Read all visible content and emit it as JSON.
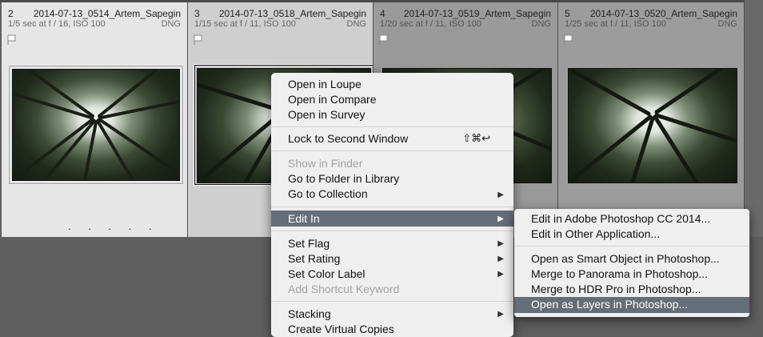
{
  "cells": [
    {
      "num": "2",
      "filename": "2014-07-13_0514_Artem_Sapegin",
      "exposure": "1/5 sec at f / 16, ISO 100",
      "format": "DNG"
    },
    {
      "num": "3",
      "filename": "2014-07-13_0518_Artem_Sapegin",
      "exposure": "1/15 sec at f / 11, ISO 100",
      "format": "DNG"
    },
    {
      "num": "4",
      "filename": "2014-07-13_0519_Artem_Sapegin",
      "exposure": "1/20 sec at f / 11, ISO 100",
      "format": "DNG"
    },
    {
      "num": "5",
      "filename": "2014-07-13_0520_Artem_Sapegin",
      "exposure": "1/25 sec at f / 11, ISO 100",
      "format": "DNG"
    }
  ],
  "rating_dots": ". . . . .",
  "icons": {
    "flag": "flag-icon",
    "submenu_arrow": "triangle-right-icon"
  },
  "context_menu": {
    "open_in_loupe": "Open in Loupe",
    "open_in_compare": "Open in Compare",
    "open_in_survey": "Open in Survey",
    "lock_second_window": "Lock to Second Window",
    "lock_shortcut": "⇧⌘↩",
    "show_in_finder": "Show in Finder",
    "go_to_folder": "Go to Folder in Library",
    "go_to_collection": "Go to Collection",
    "edit_in": "Edit In",
    "set_flag": "Set Flag",
    "set_rating": "Set Rating",
    "set_color_label": "Set Color Label",
    "add_shortcut_keyword": "Add Shortcut Keyword",
    "stacking": "Stacking",
    "create_virtual_copies": "Create Virtual Copies"
  },
  "submenu": {
    "edit_photoshop": "Edit in Adobe Photoshop CC 2014...",
    "edit_other": "Edit in Other Application...",
    "open_smart_object": "Open as Smart Object in Photoshop...",
    "merge_panorama": "Merge to Panorama in Photoshop...",
    "merge_hdr": "Merge to HDR Pro in Photoshop...",
    "open_as_layers": "Open as Layers in Photoshop..."
  },
  "colors": {
    "highlight": "#656d78",
    "menu_bg": "#efefef",
    "background": "#5f5f5f"
  }
}
